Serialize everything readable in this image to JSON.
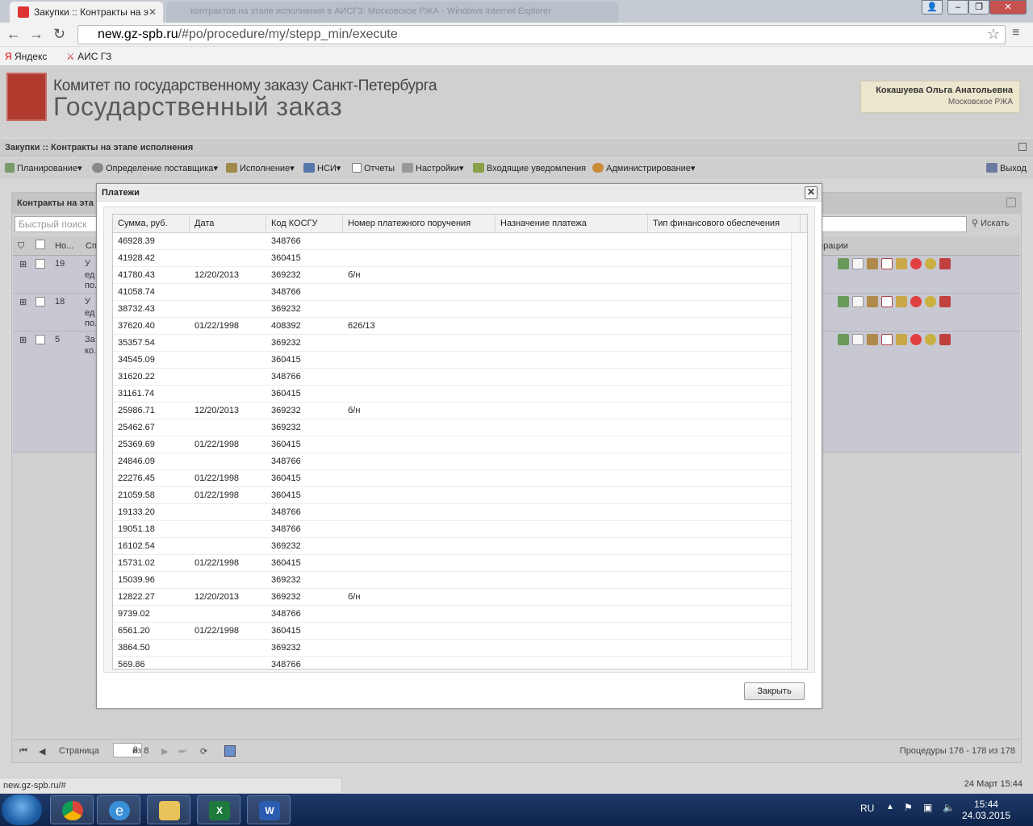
{
  "browser": {
    "tab_active": "Закупки :: Контракты на э",
    "tab_inactive": "контрактов на этапе исполнения в АИСГЗ: Московское РЖА - Windows Internet Explorer",
    "url_host": "new.gz-spb.ru",
    "url_path": "/#po/procedure/my/stepp_min/execute",
    "bookmarks": [
      "Яндекс",
      "АИС ГЗ"
    ],
    "status_url": "new.gz-spb.ru/#",
    "status_date": "24 Март 15:44"
  },
  "header": {
    "line1": "Комитет по государственному заказу Санкт-Петербурга",
    "line2": "Государственный заказ",
    "user_name": "Кокашуева Ольга Анатольевна",
    "user_org": "Московское РЖА"
  },
  "module_title": "Закупки :: Контракты на этапе исполнения",
  "menu": {
    "items": [
      "Планирование",
      "Определение поставщика",
      "Исполнение",
      "НСИ",
      "Отчеты",
      "Настройки",
      "Входящие уведомления",
      "Администрирование"
    ],
    "exit": "Выход"
  },
  "panel": {
    "title": "Контракты на эта",
    "search_placeholder": "Быстрый поиск",
    "search_button": "Искать",
    "col_num": "Но...",
    "col_sp": "Сп",
    "col_ops": "ерации",
    "rows": [
      {
        "num": "19",
        "l1": "У",
        "l2": "ед",
        "l3": "по."
      },
      {
        "num": "18",
        "l1": "У",
        "l2": "ед",
        "l3": "по."
      },
      {
        "num": "5",
        "l1": "За",
        "l2": "ко.",
        "l3": ""
      }
    ]
  },
  "pager": {
    "page_label": "Страница",
    "page_value": "8",
    "of_label": "из 8",
    "summary": "Процедуры 176 - 178 из 178"
  },
  "dialog": {
    "title": "Платежи",
    "close_label": "Закрыть",
    "columns": [
      "Сумма, руб.",
      "Дата",
      "Код КОСГУ",
      "Номер платежного поручения",
      "Назначение платежа",
      "Тип финансового обеспечения"
    ],
    "rows": [
      [
        "46928.39",
        "",
        "348766",
        "",
        "",
        ""
      ],
      [
        "41928.42",
        "",
        "360415",
        "",
        "",
        ""
      ],
      [
        "41780.43",
        "12/20/2013",
        "369232",
        "б/н",
        "",
        ""
      ],
      [
        "41058.74",
        "",
        "348766",
        "",
        "",
        ""
      ],
      [
        "38732.43",
        "",
        "369232",
        "",
        "",
        ""
      ],
      [
        "37620.40",
        "01/22/1998",
        "408392",
        "626/13",
        "",
        ""
      ],
      [
        "35357.54",
        "",
        "369232",
        "",
        "",
        ""
      ],
      [
        "34545.09",
        "",
        "360415",
        "",
        "",
        ""
      ],
      [
        "31620.22",
        "",
        "348766",
        "",
        "",
        ""
      ],
      [
        "31161.74",
        "",
        "360415",
        "",
        "",
        ""
      ],
      [
        "25986.71",
        "12/20/2013",
        "369232",
        "б/н",
        "",
        ""
      ],
      [
        "25462.67",
        "",
        "369232",
        "",
        "",
        ""
      ],
      [
        "25369.69",
        "01/22/1998",
        "360415",
        "",
        "",
        ""
      ],
      [
        "24846.09",
        "",
        "348766",
        "",
        "",
        ""
      ],
      [
        "22276.45",
        "01/22/1998",
        "360415",
        "",
        "",
        ""
      ],
      [
        "21059.58",
        "01/22/1998",
        "360415",
        "",
        "",
        ""
      ],
      [
        "19133.20",
        "",
        "348766",
        "",
        "",
        ""
      ],
      [
        "19051.18",
        "",
        "348766",
        "",
        "",
        ""
      ],
      [
        "16102.54",
        "",
        "369232",
        "",
        "",
        ""
      ],
      [
        "15731.02",
        "01/22/1998",
        "360415",
        "",
        "",
        ""
      ],
      [
        "15039.96",
        "",
        "369232",
        "",
        "",
        ""
      ],
      [
        "12822.27",
        "12/20/2013",
        "369232",
        "б/н",
        "",
        ""
      ],
      [
        "9739.02",
        "",
        "348766",
        "",
        "",
        ""
      ],
      [
        "6561.20",
        "01/22/1998",
        "360415",
        "",
        "",
        ""
      ],
      [
        "3864.50",
        "",
        "369232",
        "",
        "",
        ""
      ],
      [
        "569.86",
        "",
        "348766",
        "",
        "",
        ""
      ]
    ]
  },
  "taskbar": {
    "lang": "RU",
    "time": "15:44",
    "date": "24.03.2015"
  }
}
